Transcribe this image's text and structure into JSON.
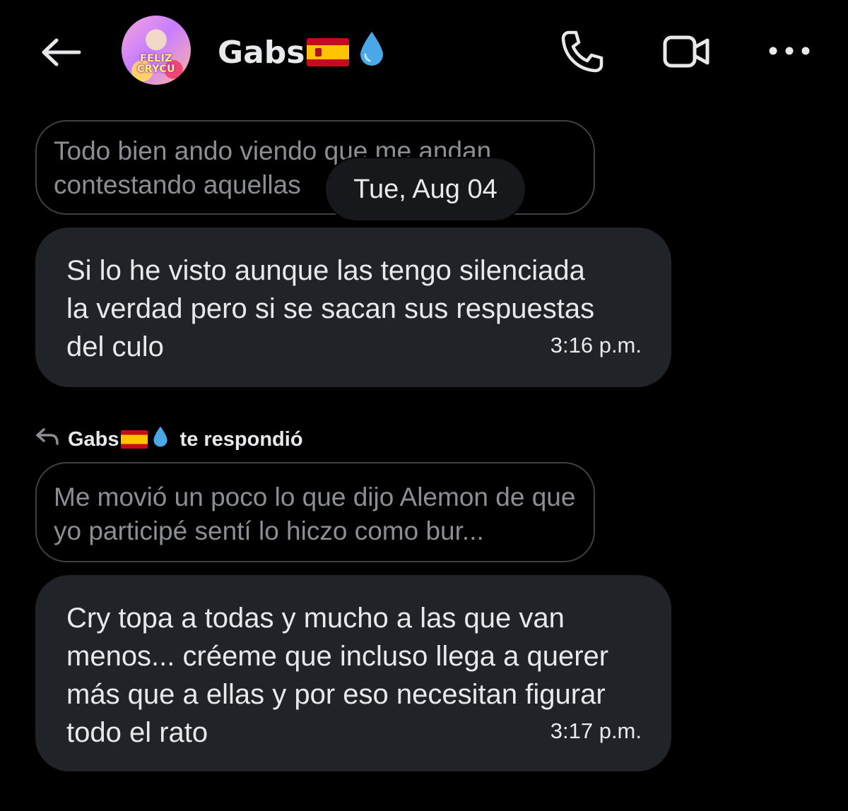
{
  "header": {
    "back_icon": "arrow-left-icon",
    "avatar_text": "FELIZ CRYCU",
    "contact_name": "Gabs",
    "call_icon": "phone-icon",
    "video_icon": "video-camera-icon",
    "more_icon": "more-horizontal-icon"
  },
  "conversation": {
    "quoted_1": "Todo bien ando viendo que me andan contestando aquellas",
    "date_separator": "Tue, Aug 04",
    "message_1": {
      "text": "Si lo he visto aunque las tengo silenciada la verdad pero si se sacan sus respuestas del culo",
      "time": "3:16 p.m."
    },
    "reply_indicator": {
      "name": "Gabs",
      "label": "te respondió"
    },
    "quoted_2": "Me movió un poco lo que dijo Alemon de que yo participé sentí lo hiczo como bur...",
    "message_2": {
      "text": "Cry topa a todas y mucho a las que van menos... créeme que incluso llega a querer más que a ellas y por eso necesitan figurar todo el rato",
      "time": "3:17 p.m."
    }
  },
  "colors": {
    "background": "#000000",
    "bubble": "#202327",
    "quote_border": "#3e4144",
    "text_primary": "#e7e9ea",
    "text_muted": "#8b8f94",
    "drop": "#4aa8e8"
  }
}
